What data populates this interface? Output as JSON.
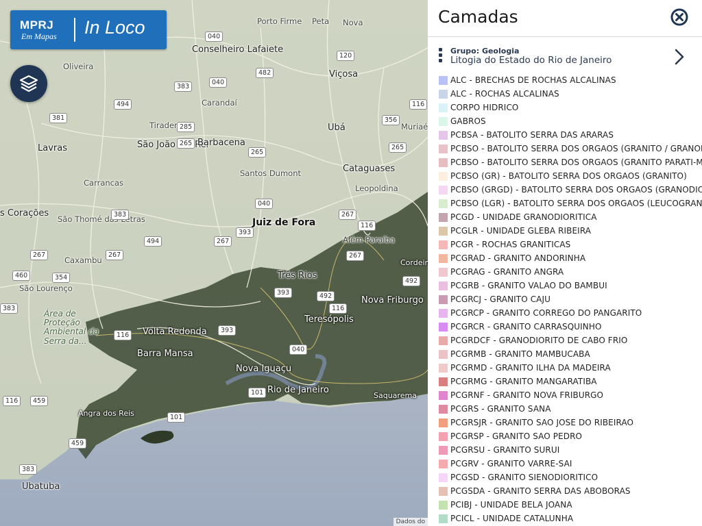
{
  "app": {
    "logo_org": "MPRJ",
    "logo_sub": "Em Mapas",
    "logo_product": "In Loco"
  },
  "icons": {
    "layers": "layers-icon",
    "close": "close-circle-icon",
    "drag": "drag-handle-icon",
    "chevron": "chevron-right-icon"
  },
  "colors": {
    "brand_blue": "#1f6fbb",
    "layers_button": "#1f3553",
    "panel_text": "#2a3a52"
  },
  "map": {
    "credit": "Dados do",
    "places": [
      {
        "name": "Porto Firme",
        "cls": ""
      },
      {
        "name": "Peta",
        "cls": ""
      },
      {
        "name": "Nova",
        "cls": ""
      },
      {
        "name": "Conselheiro Lafaiete",
        "cls": "city"
      },
      {
        "name": "Oliveira",
        "cls": ""
      },
      {
        "name": "Viçosa",
        "cls": "city"
      },
      {
        "name": "Carandaí",
        "cls": ""
      },
      {
        "name": "Tiradentes",
        "cls": ""
      },
      {
        "name": "Ubá",
        "cls": "city"
      },
      {
        "name": "Muriaé",
        "cls": ""
      },
      {
        "name": "Lavras",
        "cls": "city"
      },
      {
        "name": "São João del Rei",
        "cls": "city"
      },
      {
        "name": "Barbacena",
        "cls": "city"
      },
      {
        "name": "Santos Dumont",
        "cls": ""
      },
      {
        "name": "Cataguases",
        "cls": "city"
      },
      {
        "name": "Carrancas",
        "cls": ""
      },
      {
        "name": "Leopoldina",
        "cls": ""
      },
      {
        "name": "s Corações",
        "cls": "city"
      },
      {
        "name": "São Thomé das Letras",
        "cls": ""
      },
      {
        "name": "Juiz de Fora",
        "cls": "big"
      },
      {
        "name": "Além Paraíba",
        "cls": ""
      },
      {
        "name": "Caxambu",
        "cls": ""
      },
      {
        "name": "Cordeiro",
        "cls": "dark small"
      },
      {
        "name": "Três Rios",
        "cls": "city"
      },
      {
        "name": "São Lourenço",
        "cls": ""
      },
      {
        "name": "Nova Friburgo",
        "cls": "dark"
      },
      {
        "name": "Área de Proteção Ambiental da Serra da...",
        "cls": "park"
      },
      {
        "name": "Teresópolis",
        "cls": "dark"
      },
      {
        "name": "Volta Redonda",
        "cls": "dark"
      },
      {
        "name": "Barra Mansa",
        "cls": "dark"
      },
      {
        "name": "Nova Iguaçu",
        "cls": "dark"
      },
      {
        "name": "Rio de Janeiro",
        "cls": "dark"
      },
      {
        "name": "Saquarema",
        "cls": "dark small"
      },
      {
        "name": "Angra dos Reis",
        "cls": "dark small"
      },
      {
        "name": "Ubatuba",
        "cls": "city"
      }
    ],
    "shields": [
      "040",
      "120",
      "482",
      "383",
      "040",
      "494",
      "116",
      "381",
      "356",
      "265",
      "265",
      "265",
      "040",
      "285",
      "116",
      "267",
      "383",
      "267",
      "494",
      "267",
      "393",
      "267",
      "267",
      "460",
      "354",
      "492",
      "116",
      "393",
      "492",
      "383",
      "116",
      "393",
      "040",
      "101",
      "101",
      "116",
      "459",
      "459",
      "383"
    ]
  },
  "panel": {
    "title": "Camadas",
    "group_label": "Grupo: Geologia",
    "group_layer": "Litogia do Estado do Rio de Janeiro",
    "legend": [
      {
        "label": "ALC - BRECHAS DE ROCHAS ALCALINAS",
        "color": "#b9c2f4"
      },
      {
        "label": "ALC - ROCHAS ALCALINAS",
        "color": "#c8d5e6"
      },
      {
        "label": "CORPO HIDRICO",
        "color": "#dbf1f8"
      },
      {
        "label": "GABROS",
        "color": "#dcf5e9"
      },
      {
        "label": "PCBSA - BATOLITO SERRA DAS ARARAS",
        "color": "#e4c6ea"
      },
      {
        "label": "PCBSO - BATOLITO SERRA DOS ORGAOS (GRANITO / GRANOI",
        "color": "#e7c2c8"
      },
      {
        "label": "PCBSO - BATOLITO SERRA DOS ORGAOS (GRANITO PARATI-M",
        "color": "#e6bdc0"
      },
      {
        "label": "PCBSO (GR) - BATOLITO SERRA DOS ORGAOS (GRANITO)",
        "color": "#fcefe0"
      },
      {
        "label": "PCBSO (GRGD) - BATOLITO SERRA DOS ORGAOS (GRANODIOI",
        "color": "#f4d8f2"
      },
      {
        "label": "PCBSO (LGR) - BATOLITO SERRA DOS ORGAOS (LEUCOGRANIT",
        "color": "#d8ecd0"
      },
      {
        "label": "PCGD - UNIDADE GRANODIORITICA",
        "color": "#c4a4ae"
      },
      {
        "label": "PCGLR - UNIDADE GLEBA RIBEIRA",
        "color": "#dac8a9"
      },
      {
        "label": "PCGR - ROCHAS GRANITICAS",
        "color": "#f5b8b8"
      },
      {
        "label": "PCGRAD - GRANITO ANDORINHA",
        "color": "#f2b89f"
      },
      {
        "label": "PCGRAG - GRANITO ANGRA",
        "color": "#f0c6cf"
      },
      {
        "label": "PCGRB - GRANITO VALAO DO BAMBUI",
        "color": "#e9bede"
      },
      {
        "label": "PCGRCJ - GRANITO CAJU",
        "color": "#c99ab2"
      },
      {
        "label": "PCGRCP - GRANITO CORREGO DO PANGARITO",
        "color": "#e7b5ee"
      },
      {
        "label": "PCGRCR - GRANITO CARRASQUINHO",
        "color": "#d98af3"
      },
      {
        "label": "PCGRDCF - GRANODIORITO DE CABO FRIO",
        "color": "#e9aaaa"
      },
      {
        "label": "PCGRMB - GRANITO MAMBUCABA",
        "color": "#ebc3c6"
      },
      {
        "label": "PCGRMD - GRANITO ILHA DA MADEIRA",
        "color": "#efcaca"
      },
      {
        "label": "PCGRMG - GRANITO MANGARATIBA",
        "color": "#d87f80"
      },
      {
        "label": "PCGRNF - GRANITO NOVA FRIBURGO",
        "color": "#df86cf"
      },
      {
        "label": "PCGRS - GRANITO SANA",
        "color": "#e08aa1"
      },
      {
        "label": "PCGRSJR - GRANITO SAO JOSE DO RIBEIRAO",
        "color": "#f0a07c"
      },
      {
        "label": "PCGRSP - GRANITO SAO PEDRO",
        "color": "#f2a1b0"
      },
      {
        "label": "PCGRSU - GRANITO SURUI",
        "color": "#ee9ab7"
      },
      {
        "label": "PCGRV - GRANITO VARRE-SAI",
        "color": "#f5aab0"
      },
      {
        "label": "PCGSD - GRANITO SIENODIORITICO",
        "color": "#f4d7f7"
      },
      {
        "label": "PCGSDA - GRANITO SERRA DAS ABOBORAS",
        "color": "#e5c0b4"
      },
      {
        "label": "PCIBJ - UNIDADE BELA JOANA",
        "color": "#c4e2b0"
      },
      {
        "label": "PCICL - UNIDADE CATALUNHA",
        "color": "#b0dcc8"
      }
    ]
  }
}
